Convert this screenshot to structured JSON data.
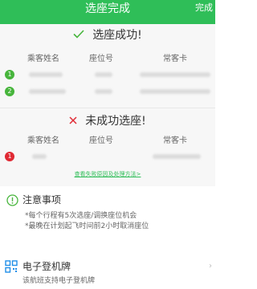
{
  "header": {
    "title": "选座完成",
    "action_label": "完成"
  },
  "success": {
    "title": "选座成功!",
    "columns": {
      "name": "乘客姓名",
      "seat": "座位号",
      "card": "常客卡"
    },
    "rows": [
      {
        "index": "1"
      },
      {
        "index": "2"
      }
    ]
  },
  "failure": {
    "title": "未成功选座!",
    "columns": {
      "name": "乘客姓名",
      "seat": "座位号",
      "card": "常客卡"
    },
    "rows": [
      {
        "index": "1"
      }
    ],
    "link_text": "查看失败原因及处理方法>"
  },
  "notes": {
    "title": "注意事项",
    "lines": [
      "*每个行程有5次选座/调换座位机会",
      "*最晚在计划起飞时间前2小时取消座位"
    ]
  },
  "boarding_pass": {
    "title": "电子登机牌",
    "subtitle": "该航班支持电子登机牌"
  },
  "colors": {
    "brand_green": "#2fbe58",
    "success_badge": "#47b53c",
    "fail_badge": "#e02a34",
    "fail_mark": "#e02a34"
  },
  "icons": {
    "success_mark": "check-icon",
    "fail_mark": "cross-icon",
    "notes": "info-circle-icon",
    "boarding": "qr-code-icon",
    "more": "chevron-right-icon"
  }
}
